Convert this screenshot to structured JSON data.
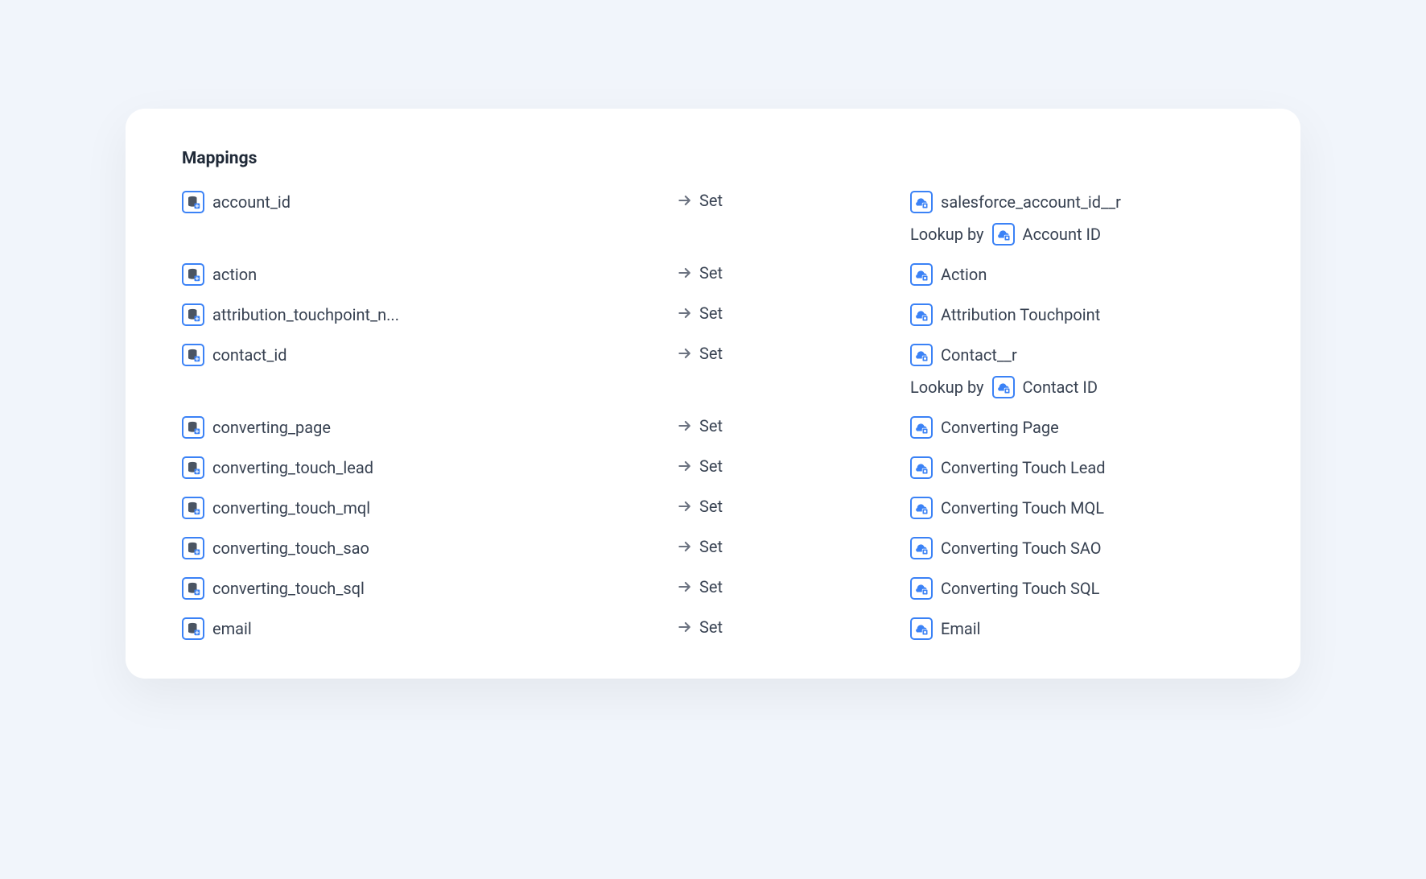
{
  "title": "Mappings",
  "lookup_prefix": "Lookup by",
  "rows": [
    {
      "source": "account_id",
      "op": "Set",
      "dest": "salesforce_account_id__r",
      "lookup": "Account ID"
    },
    {
      "source": "action",
      "op": "Set",
      "dest": "Action"
    },
    {
      "source": "attribution_touchpoint_n...",
      "op": "Set",
      "dest": "Attribution Touchpoint"
    },
    {
      "source": "contact_id",
      "op": "Set",
      "dest": "Contact__r",
      "lookup": "Contact ID"
    },
    {
      "source": "converting_page",
      "op": "Set",
      "dest": "Converting Page"
    },
    {
      "source": "converting_touch_lead",
      "op": "Set",
      "dest": "Converting Touch Lead"
    },
    {
      "source": "converting_touch_mql",
      "op": "Set",
      "dest": "Converting Touch MQL"
    },
    {
      "source": "converting_touch_sao",
      "op": "Set",
      "dest": "Converting Touch SAO"
    },
    {
      "source": "converting_touch_sql",
      "op": "Set",
      "dest": "Converting Touch SQL"
    },
    {
      "source": "email",
      "op": "Set",
      "dest": "Email"
    }
  ]
}
